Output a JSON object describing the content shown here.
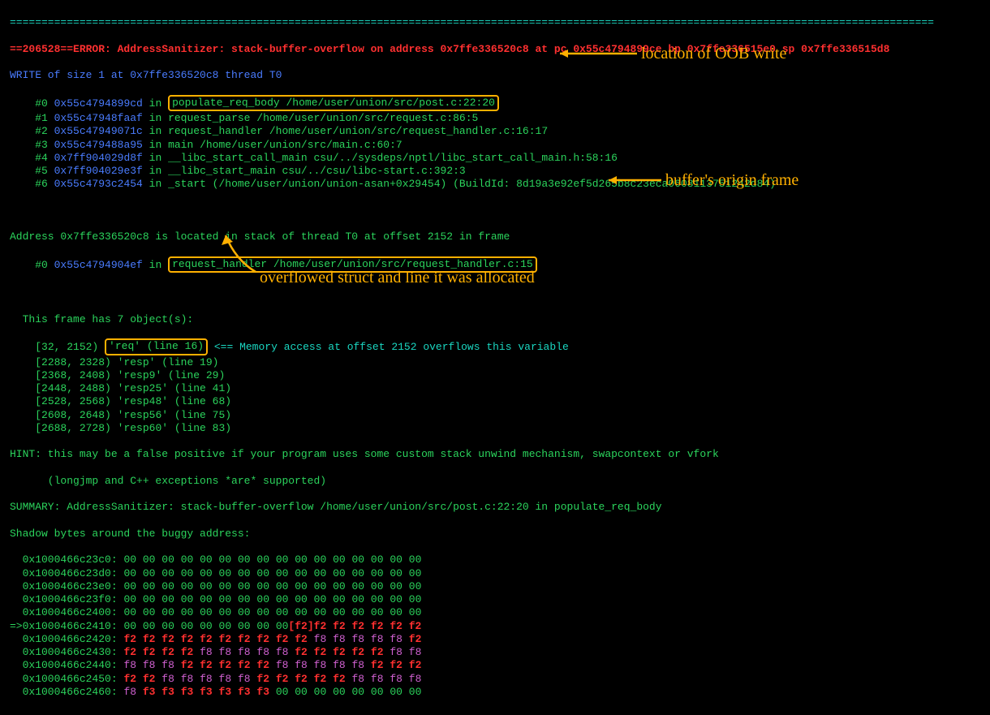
{
  "separator": "==================================================================================================================================================",
  "error_line": "==206528==ERROR: AddressSanitizer: stack-buffer-overflow on address 0x7ffe336520c8 at pc 0x55c4794899ce bp 0x7ffe336515e0 sp 0x7ffe336515d8",
  "write_header": "WRITE of size 1 at 0x7ffe336520c8 thread T0",
  "stack": [
    {
      "idx": "#0",
      "addr": "0x55c4794899cd",
      "in": "in",
      "loc": "populate_req_body /home/user/union/src/post.c:22:20",
      "hl": true
    },
    {
      "idx": "#1",
      "addr": "0x55c47948faaf",
      "in": "in",
      "loc": "request_parse /home/user/union/src/request.c:86:5"
    },
    {
      "idx": "#2",
      "addr": "0x55c47949071c",
      "in": "in",
      "loc": "request_handler /home/user/union/src/request_handler.c:16:17"
    },
    {
      "idx": "#3",
      "addr": "0x55c479488a95",
      "in": "in",
      "loc": "main /home/user/union/src/main.c:60:7"
    },
    {
      "idx": "#4",
      "addr": "0x7ff904029d8f",
      "in": "in",
      "loc": "__libc_start_call_main csu/../sysdeps/nptl/libc_start_call_main.h:58:16"
    },
    {
      "idx": "#5",
      "addr": "0x7ff904029e3f",
      "in": "in",
      "loc": "__libc_start_main csu/../csu/libc-start.c:392:3"
    },
    {
      "idx": "#6",
      "addr": "0x55c4793c2454",
      "in": "in",
      "loc": "_start (/home/user/union/union-asan+0x29454) (BuildId: 8d19a3e92ef5d265b8c23eca0608113751242d84)"
    }
  ],
  "addr_located": "Address 0x7ffe336520c8 is located in stack of thread T0 at offset 2152 in frame",
  "origin_frame": {
    "idx": "#0",
    "addr": "0x55c4794904ef",
    "in": "in",
    "loc": "request_handler /home/user/union/src/request_handler.c:15"
  },
  "frame_objs_header": "  This frame has 7 object(s):",
  "frame_objs": [
    {
      "range": "[32, 2152)",
      "name": "'req' (line 16)",
      "note": " <== Memory access at offset 2152 overflows this variable",
      "hl": true
    },
    {
      "range": "[2288, 2328)",
      "name": "'resp' (line 19)"
    },
    {
      "range": "[2368, 2408)",
      "name": "'resp9' (line 29)"
    },
    {
      "range": "[2448, 2488)",
      "name": "'resp25' (line 41)"
    },
    {
      "range": "[2528, 2568)",
      "name": "'resp48' (line 68)"
    },
    {
      "range": "[2608, 2648)",
      "name": "'resp56' (line 75)"
    },
    {
      "range": "[2688, 2728)",
      "name": "'resp60' (line 83)"
    }
  ],
  "hint1": "HINT: this may be a false positive if your program uses some custom stack unwind mechanism, swapcontext or vfork",
  "hint2": "      (longjmp and C++ exceptions *are* supported)",
  "summary": "SUMMARY: AddressSanitizer: stack-buffer-overflow /home/user/union/src/post.c:22:20 in populate_req_body",
  "shadow_header": "Shadow bytes around the buggy address:",
  "shadow": [
    {
      "pfx": "  ",
      "addr": "0x1000466c23c0:",
      "bytes": [
        "00",
        "00",
        "00",
        "00",
        "00",
        "00",
        "00",
        "00",
        "00",
        "00",
        "00",
        "00",
        "00",
        "00",
        "00",
        "00"
      ]
    },
    {
      "pfx": "  ",
      "addr": "0x1000466c23d0:",
      "bytes": [
        "00",
        "00",
        "00",
        "00",
        "00",
        "00",
        "00",
        "00",
        "00",
        "00",
        "00",
        "00",
        "00",
        "00",
        "00",
        "00"
      ]
    },
    {
      "pfx": "  ",
      "addr": "0x1000466c23e0:",
      "bytes": [
        "00",
        "00",
        "00",
        "00",
        "00",
        "00",
        "00",
        "00",
        "00",
        "00",
        "00",
        "00",
        "00",
        "00",
        "00",
        "00"
      ]
    },
    {
      "pfx": "  ",
      "addr": "0x1000466c23f0:",
      "bytes": [
        "00",
        "00",
        "00",
        "00",
        "00",
        "00",
        "00",
        "00",
        "00",
        "00",
        "00",
        "00",
        "00",
        "00",
        "00",
        "00"
      ]
    },
    {
      "pfx": "  ",
      "addr": "0x1000466c2400:",
      "bytes": [
        "00",
        "00",
        "00",
        "00",
        "00",
        "00",
        "00",
        "00",
        "00",
        "00",
        "00",
        "00",
        "00",
        "00",
        "00",
        "00"
      ]
    },
    {
      "pfx": "=>",
      "addr": "0x1000466c2410:",
      "bytes": [
        "00",
        "00",
        "00",
        "00",
        "00",
        "00",
        "00",
        "00",
        "00",
        "[f2]",
        "f2",
        "f2",
        "f2",
        "f2",
        "f2",
        "f2"
      ]
    },
    {
      "pfx": "  ",
      "addr": "0x1000466c2420:",
      "bytes": [
        "f2",
        "f2",
        "f2",
        "f2",
        "f2",
        "f2",
        "f2",
        "f2",
        "f2",
        "f2",
        "f8",
        "f8",
        "f8",
        "f8",
        "f8",
        "f2"
      ]
    },
    {
      "pfx": "  ",
      "addr": "0x1000466c2430:",
      "bytes": [
        "f2",
        "f2",
        "f2",
        "f2",
        "f8",
        "f8",
        "f8",
        "f8",
        "f8",
        "f2",
        "f2",
        "f2",
        "f2",
        "f2",
        "f8",
        "f8"
      ]
    },
    {
      "pfx": "  ",
      "addr": "0x1000466c2440:",
      "bytes": [
        "f8",
        "f8",
        "f8",
        "f2",
        "f2",
        "f2",
        "f2",
        "f2",
        "f8",
        "f8",
        "f8",
        "f8",
        "f8",
        "f2",
        "f2",
        "f2"
      ]
    },
    {
      "pfx": "  ",
      "addr": "0x1000466c2450:",
      "bytes": [
        "f2",
        "f2",
        "f8",
        "f8",
        "f8",
        "f8",
        "f8",
        "f2",
        "f2",
        "f2",
        "f2",
        "f2",
        "f8",
        "f8",
        "f8",
        "f8"
      ]
    },
    {
      "pfx": "  ",
      "addr": "0x1000466c2460:",
      "bytes": [
        "f8",
        "f3",
        "f3",
        "f3",
        "f3",
        "f3",
        "f3",
        "f3",
        "00",
        "00",
        "00",
        "00",
        "00",
        "00",
        "00",
        "00"
      ]
    }
  ],
  "annotations": {
    "a1": "location of OOB write",
    "a2": "buffer's origin frame",
    "a3": "overflowed struct and line it was allocated"
  }
}
